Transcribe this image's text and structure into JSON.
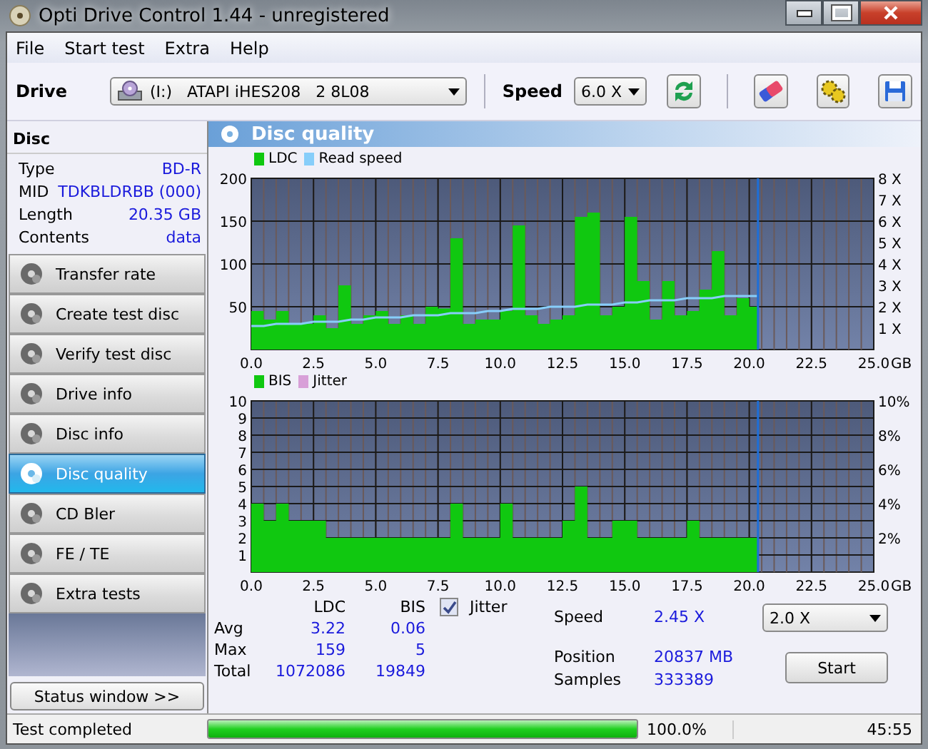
{
  "window": {
    "title": "Opti Drive Control 1.44 - unregistered"
  },
  "menu": [
    "File",
    "Start test",
    "Extra",
    "Help"
  ],
  "toolbar": {
    "drive_label": "Drive",
    "drive": "(I:)   ATAPI iHES208   2 8L08",
    "speed_label": "Speed",
    "speed": "6.0 X"
  },
  "disc": {
    "title": "Disc",
    "rows": [
      {
        "label": "Type",
        "value": "BD-R"
      },
      {
        "label": "MID",
        "value": "TDKBLDRBB (000)"
      },
      {
        "label": "Length",
        "value": "20.35 GB"
      },
      {
        "label": "Contents",
        "value": "data"
      }
    ]
  },
  "nav": [
    {
      "label": "Transfer rate",
      "selected": false
    },
    {
      "label": "Create test disc",
      "selected": false
    },
    {
      "label": "Verify test disc",
      "selected": false
    },
    {
      "label": "Drive info",
      "selected": false
    },
    {
      "label": "Disc info",
      "selected": false
    },
    {
      "label": "Disc quality",
      "selected": true
    },
    {
      "label": "CD Bler",
      "selected": false
    },
    {
      "label": "FE / TE",
      "selected": false
    },
    {
      "label": "Extra tests",
      "selected": false
    }
  ],
  "status_window_button": "Status window >>",
  "panel_title": "Disc quality",
  "charts": [
    {
      "chart_data": {
        "type": "area",
        "xlabel": "GB",
        "xlim": [
          0,
          25
        ],
        "ylim": [
          0,
          200
        ],
        "y2lim": [
          0,
          8
        ],
        "x": [
          0,
          0.5,
          1,
          1.5,
          2,
          2.5,
          3,
          3.5,
          4,
          4.5,
          5,
          5.5,
          6,
          6.5,
          7,
          7.5,
          8,
          8.5,
          9,
          9.5,
          10,
          10.5,
          11,
          11.5,
          12,
          12.5,
          13,
          13.5,
          14,
          14.5,
          15,
          15.5,
          16,
          16.5,
          17,
          17.5,
          18,
          18.5,
          19,
          19.5,
          20,
          20.35
        ],
        "series": [
          {
            "name": "LDC",
            "color": "#10c810",
            "values": [
              45,
              35,
              45,
              30,
              30,
              40,
              25,
              75,
              30,
              40,
              45,
              30,
              40,
              30,
              50,
              48,
              130,
              30,
              35,
              35,
              45,
              145,
              40,
              30,
              35,
              40,
              155,
              160,
              40,
              50,
              155,
              80,
              35,
              80,
              40,
              45,
              70,
              115,
              40,
              60,
              50,
              50
            ]
          },
          {
            "name": "Read speed",
            "color": "#87cefa",
            "type": "line",
            "axis": "y2",
            "values": [
              1.1,
              1.1,
              1.2,
              1.2,
              1.2,
              1.3,
              1.3,
              1.3,
              1.4,
              1.4,
              1.5,
              1.5,
              1.5,
              1.6,
              1.6,
              1.6,
              1.7,
              1.7,
              1.7,
              1.8,
              1.8,
              1.9,
              1.9,
              1.9,
              2.0,
              2.0,
              2.0,
              2.1,
              2.1,
              2.1,
              2.2,
              2.2,
              2.3,
              2.3,
              2.3,
              2.4,
              2.4,
              2.4,
              2.5,
              2.5,
              2.5,
              2.5
            ]
          }
        ],
        "grid": true,
        "xticks": [
          {
            "value": 0,
            "label": "0.0"
          },
          {
            "value": 2.5,
            "label": "2.5"
          },
          {
            "value": 5,
            "label": "5.0"
          },
          {
            "value": 7.5,
            "label": "7.5"
          },
          {
            "value": 10,
            "label": "10.0"
          },
          {
            "value": 12.5,
            "label": "12.5"
          },
          {
            "value": 15,
            "label": "15.0"
          },
          {
            "value": 17.5,
            "label": "17.5"
          },
          {
            "value": 20,
            "label": "20.0"
          },
          {
            "value": 22.5,
            "label": "22.5"
          },
          {
            "value": 25,
            "label": "25.0"
          }
        ],
        "yticks": [
          50,
          100,
          150,
          200
        ],
        "y2ticks": [
          {
            "value": 1,
            "label": "1 X"
          },
          {
            "value": 2,
            "label": "2 X"
          },
          {
            "value": 3,
            "label": "3 X"
          },
          {
            "value": 4,
            "label": "4 X"
          },
          {
            "value": 5,
            "label": "5 X"
          },
          {
            "value": 6,
            "label": "6 X"
          },
          {
            "value": 7,
            "label": "7 X"
          },
          {
            "value": 8,
            "label": "8 X"
          }
        ],
        "ref_lines": [
          {
            "axis": "x",
            "value": 20.35
          }
        ]
      }
    },
    {
      "chart_data": {
        "type": "area",
        "xlabel": "GB",
        "xlim": [
          0,
          25
        ],
        "ylim": [
          0,
          10
        ],
        "y2lim": [
          0,
          10
        ],
        "x": [
          0,
          0.5,
          1,
          1.5,
          2,
          2.5,
          3,
          3.5,
          4,
          4.5,
          5,
          5.5,
          6,
          6.5,
          7,
          7.5,
          8,
          8.5,
          9,
          9.5,
          10,
          10.5,
          11,
          11.5,
          12,
          12.5,
          13,
          13.5,
          14,
          14.5,
          15,
          15.5,
          16,
          16.5,
          17,
          17.5,
          18,
          18.5,
          19,
          19.5,
          20,
          20.35
        ],
        "series": [
          {
            "name": "BIS",
            "color": "#10c810",
            "values": [
              4,
              3,
              4,
              3,
              3,
              3,
              2,
              2,
              2,
              2,
              2,
              2,
              2,
              2,
              2,
              2,
              4,
              2,
              2,
              2,
              4,
              2,
              2,
              2,
              2,
              3,
              5,
              2,
              2,
              3,
              3,
              2,
              2,
              2,
              2,
              3,
              2,
              2,
              2,
              2,
              2,
              2
            ]
          },
          {
            "name": "Jitter",
            "color": "#d8a0d8",
            "type": "line",
            "values": [
              null,
              null,
              null,
              null,
              null,
              null,
              null,
              null,
              null,
              null,
              null,
              null,
              null,
              null,
              null,
              null,
              null,
              null,
              null,
              null,
              null,
              null,
              null,
              null,
              null,
              null,
              null,
              null,
              null,
              null,
              null,
              null,
              null,
              null,
              null,
              null,
              null,
              null,
              null,
              null,
              null,
              null
            ]
          }
        ],
        "grid": true,
        "xticks": [
          {
            "value": 0,
            "label": "0.0"
          },
          {
            "value": 2.5,
            "label": "2.5"
          },
          {
            "value": 5,
            "label": "5.0"
          },
          {
            "value": 7.5,
            "label": "7.5"
          },
          {
            "value": 10,
            "label": "10.0"
          },
          {
            "value": 12.5,
            "label": "12.5"
          },
          {
            "value": 15,
            "label": "15.0"
          },
          {
            "value": 17.5,
            "label": "17.5"
          },
          {
            "value": 20,
            "label": "20.0"
          },
          {
            "value": 22.5,
            "label": "22.5"
          },
          {
            "value": 25,
            "label": "25.0"
          }
        ],
        "yticks": [
          1,
          2,
          3,
          4,
          5,
          6,
          7,
          8,
          9,
          10
        ],
        "y2ticks": [
          {
            "value": 2,
            "label": "2%"
          },
          {
            "value": 4,
            "label": "4%"
          },
          {
            "value": 6,
            "label": "6%"
          },
          {
            "value": 8,
            "label": "8%"
          },
          {
            "value": 10,
            "label": "10%"
          }
        ],
        "ref_lines": [
          {
            "axis": "x",
            "value": 20.35
          }
        ]
      }
    }
  ],
  "stats": {
    "columns": [
      "LDC",
      "BIS"
    ],
    "rows": [
      {
        "label": "Avg",
        "values": [
          "3.22",
          "0.06"
        ]
      },
      {
        "label": "Max",
        "values": [
          "159",
          "5"
        ]
      },
      {
        "label": "Total",
        "values": [
          "1072086",
          "19849"
        ]
      }
    ]
  },
  "jitter": {
    "label": "Jitter",
    "checked": true
  },
  "readings": [
    {
      "label": "Speed",
      "value": "2.45 X"
    },
    {
      "label": "Position",
      "value": "20837 MB"
    },
    {
      "label": "Samples",
      "value": "333389"
    }
  ],
  "test_speed": "2.0 X",
  "start_button": "Start",
  "status_bar": {
    "text": "Test completed",
    "level": 1.0,
    "percent": "100.0%",
    "time": "45:55"
  }
}
